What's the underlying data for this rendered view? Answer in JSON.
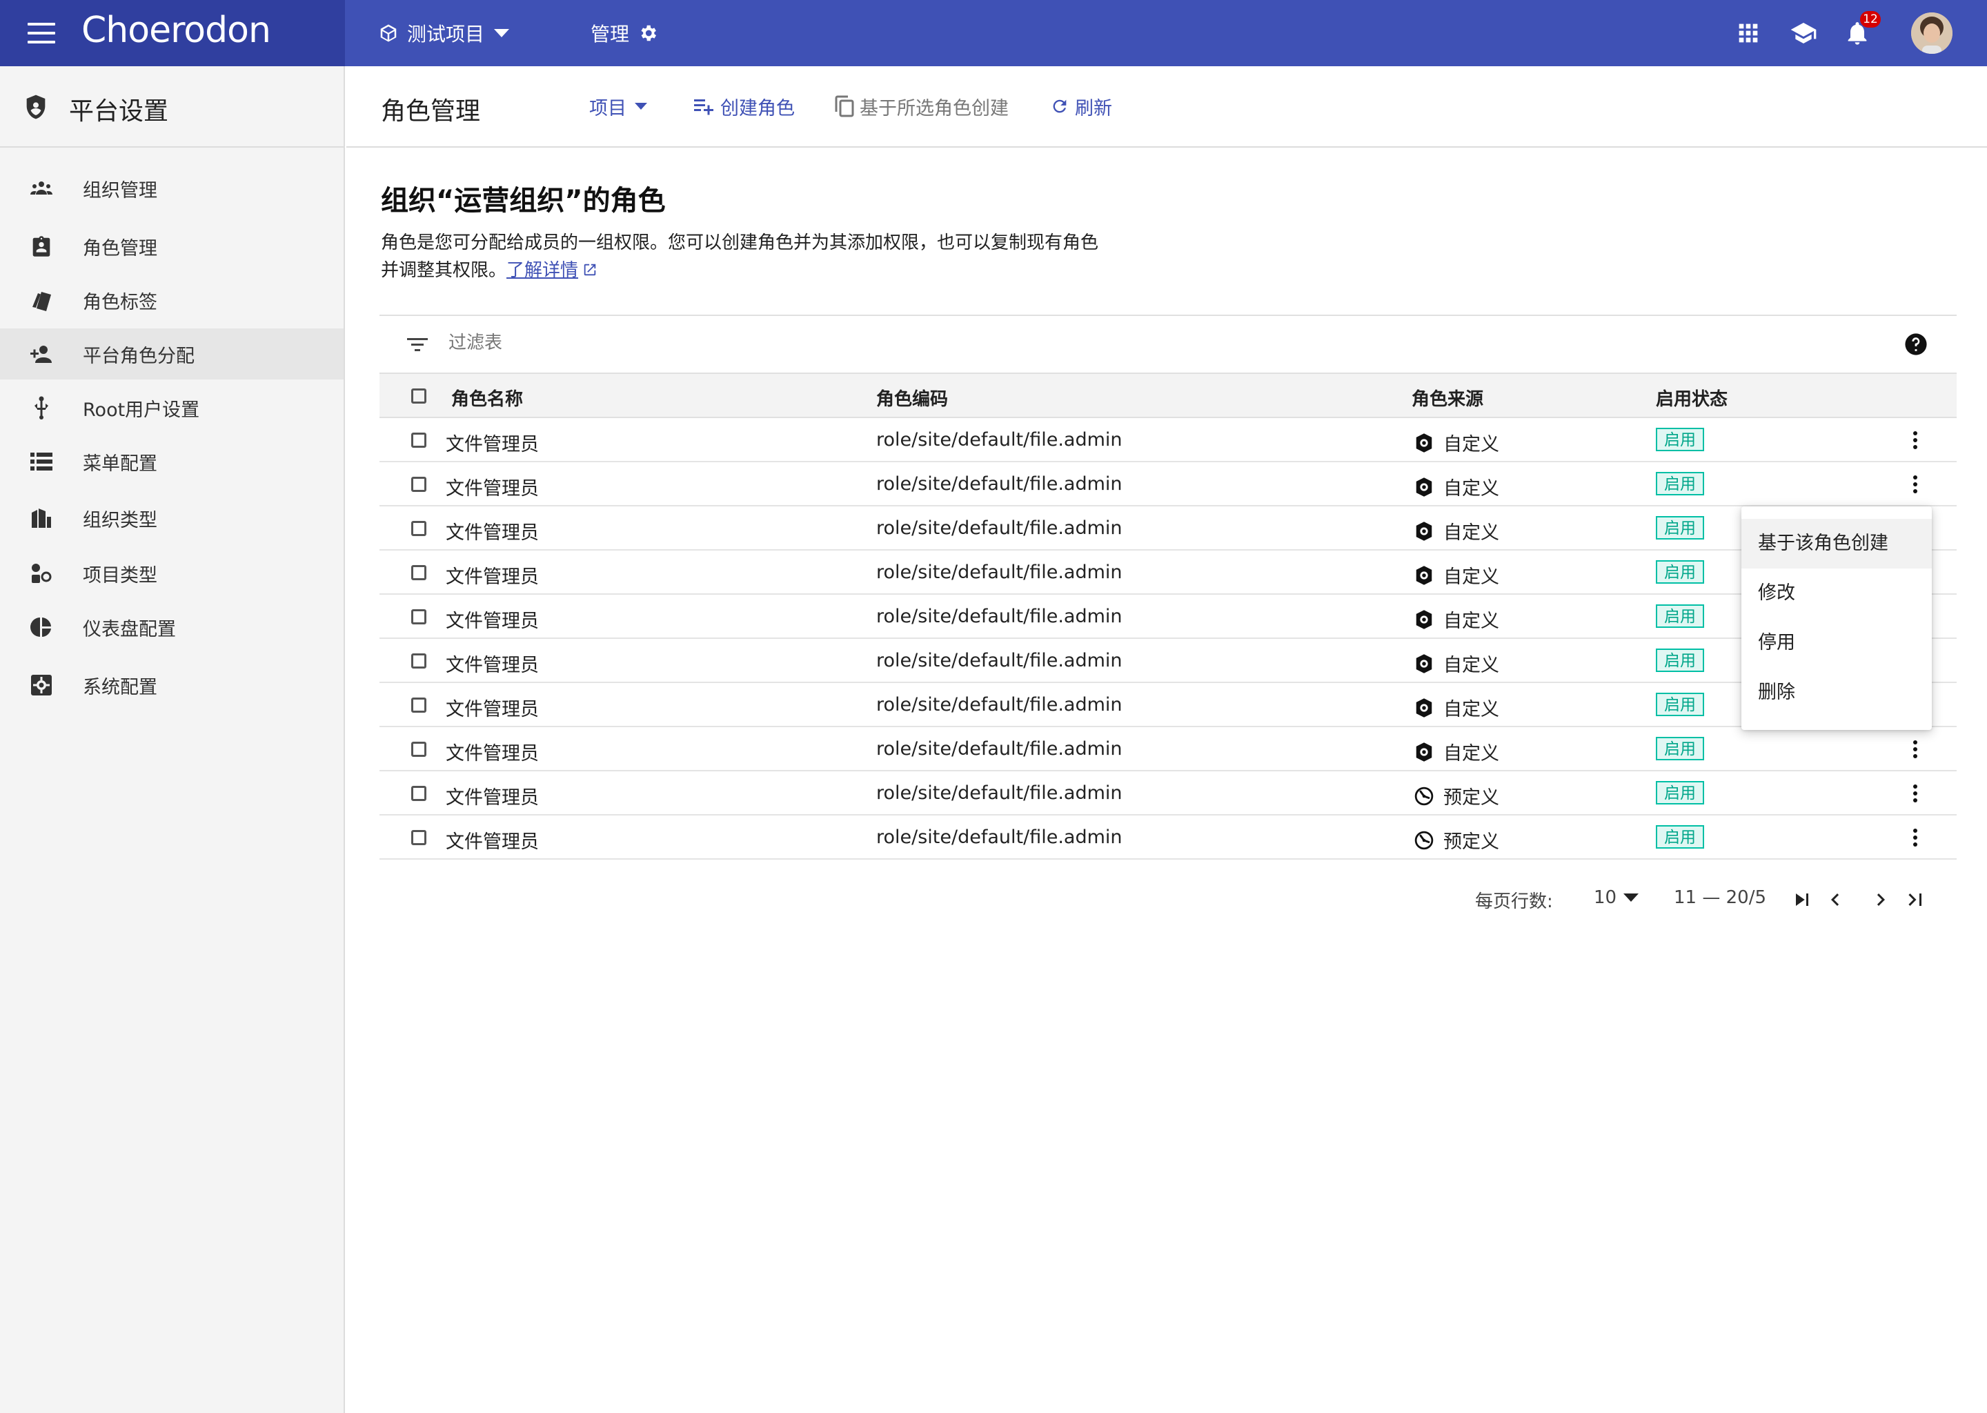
{
  "app": {
    "name": "Choerodon",
    "notification_count": "12"
  },
  "topbar": {
    "project_label": "测试项目",
    "manage_label": "管理"
  },
  "sidebar": {
    "title": "平台设置",
    "items": [
      {
        "label": "组织管理",
        "icon": "org-icon"
      },
      {
        "label": "角色管理",
        "icon": "role-badge-icon"
      },
      {
        "label": "角色标签",
        "icon": "label-icon"
      },
      {
        "label": "平台角色分配",
        "icon": "person-add-icon",
        "active": true
      },
      {
        "label": "Root用户设置",
        "icon": "root-user-icon"
      },
      {
        "label": "菜单配置",
        "icon": "list-icon"
      },
      {
        "label": "组织类型",
        "icon": "building-icon"
      },
      {
        "label": "项目类型",
        "icon": "project-type-icon"
      },
      {
        "label": "仪表盘配置",
        "icon": "dashboard-icon"
      },
      {
        "label": "系统配置",
        "icon": "settings-box-icon"
      }
    ]
  },
  "header": {
    "title": "角色管理",
    "project_dropdown": "项目",
    "create_role": "创建角色",
    "create_from_selected": "基于所选角色创建",
    "refresh": "刷新"
  },
  "main": {
    "org_title": "组织“运营组织”的角色",
    "description": "角色是您可分配给成员的一组权限。您可以创建角色并为其添加权限，也可以复制现有角色并调整其权限。",
    "learn_more": "了解详情"
  },
  "table": {
    "filter_placeholder": "过滤表",
    "columns": [
      "角色名称",
      "角色编码",
      "角色来源",
      "启用状态"
    ],
    "rows": [
      {
        "name": "文件管理员",
        "code": "role/site/default/file.admin",
        "source": "自定义",
        "status": "启用"
      },
      {
        "name": "文件管理员",
        "code": "role/site/default/file.admin",
        "source": "自定义",
        "status": "启用"
      },
      {
        "name": "文件管理员",
        "code": "role/site/default/file.admin",
        "source": "自定义",
        "status": "启用"
      },
      {
        "name": "文件管理员",
        "code": "role/site/default/file.admin",
        "source": "自定义",
        "status": "启用"
      },
      {
        "name": "文件管理员",
        "code": "role/site/default/file.admin",
        "source": "自定义",
        "status": "启用"
      },
      {
        "name": "文件管理员",
        "code": "role/site/default/file.admin",
        "source": "自定义",
        "status": "启用"
      },
      {
        "name": "文件管理员",
        "code": "role/site/default/file.admin",
        "source": "自定义",
        "status": "启用"
      },
      {
        "name": "文件管理员",
        "code": "role/site/default/file.admin",
        "source": "自定义",
        "status": "启用"
      },
      {
        "name": "文件管理员",
        "code": "role/site/default/file.admin",
        "source": "预定义",
        "status": "启用"
      },
      {
        "name": "文件管理员",
        "code": "role/site/default/file.admin",
        "source": "预定义",
        "status": "启用"
      }
    ]
  },
  "row_menu": {
    "items": [
      "基于该角色创建",
      "修改",
      "停用",
      "删除"
    ]
  },
  "pagination": {
    "rows_per_page_label": "每页行数:",
    "rows_per_page": "10",
    "range": "11 — 20/5"
  },
  "colors": {
    "primary": "#3f51b5",
    "primary_dark": "#303f9f",
    "tag_green": "#00bfa5",
    "badge_red": "#d50000"
  }
}
